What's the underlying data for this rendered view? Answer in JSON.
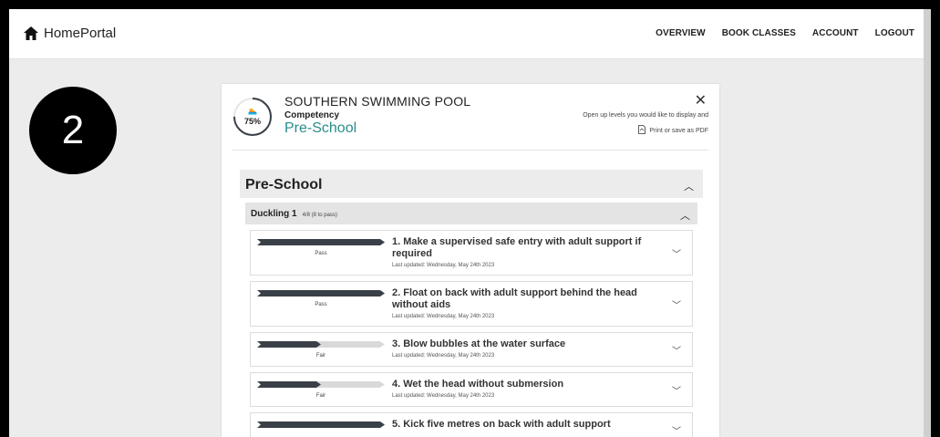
{
  "app": {
    "brand": "HomePortal"
  },
  "nav": {
    "overview": "OVERVIEW",
    "book_classes": "BOOK CLASSES",
    "account": "ACCOUNT",
    "logout": "LOGOUT"
  },
  "step_badge": "2",
  "card": {
    "progress_label": "75%",
    "progress_value": 0.75,
    "swimmer_icon": "swimmer-icon",
    "pool_name": "SOUTHERN SWIMMING POOL",
    "competency_label": "Competency",
    "level_name": "Pre-School",
    "close_glyph": "✕",
    "hint": "Open up levels you would like to display and",
    "print_label": "Print or save as PDF"
  },
  "section": {
    "title": "Pre-School"
  },
  "subsection": {
    "title": "Duckling 1",
    "meta": "4/8 (8 to pass)"
  },
  "colors": {
    "accent": "#2a8c8c",
    "bar_fill": "#3a4047",
    "bar_empty": "#d9d9d9"
  },
  "items": [
    {
      "title": "1. Make a supervised safe entry with adult support if required",
      "grade": "Pass",
      "progress": 1.0,
      "updated": "Last updated: Wednesday, May 24th 2023"
    },
    {
      "title": "2. Float on back with adult support behind the head without aids",
      "grade": "Pass",
      "progress": 1.0,
      "updated": "Last updated: Wednesday, May 24th 2023"
    },
    {
      "title": "3. Blow bubbles at the water surface",
      "grade": "Fair",
      "progress": 0.5,
      "updated": "Last updated: Wednesday, May 24th 2023"
    },
    {
      "title": "4. Wet the head without submersion",
      "grade": "Fair",
      "progress": 0.5,
      "updated": "Last updated: Wednesday, May 24th 2023"
    },
    {
      "title": "5. Kick five metres on back with adult support",
      "grade": "",
      "progress": 1.0,
      "updated": ""
    }
  ]
}
